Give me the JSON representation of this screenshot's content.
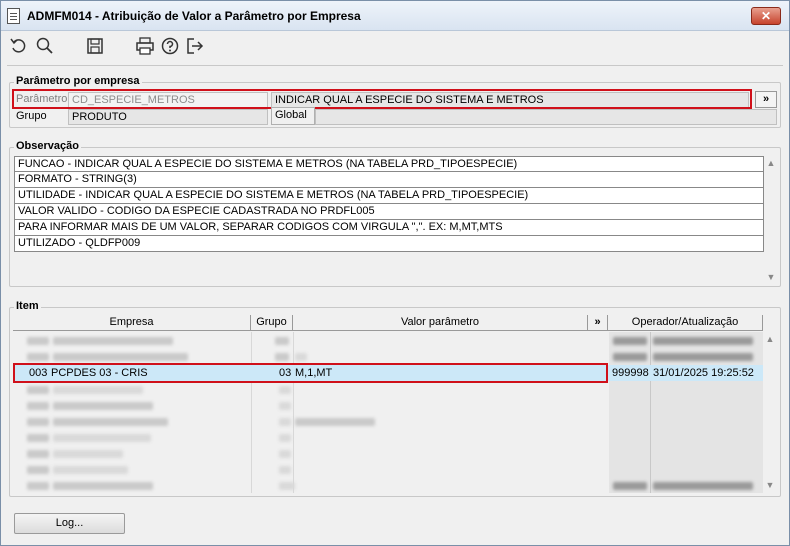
{
  "window": {
    "title": "ADMFM014 - Atribuição de Valor a Parâmetro por Empresa",
    "close_label": "✕"
  },
  "toolbar": {
    "icons": [
      "undo-icon",
      "search-icon",
      "save-icon",
      "print-icon",
      "help-icon",
      "exit-icon"
    ]
  },
  "param_section": {
    "legend": "Parâmetro por empresa",
    "param_label": "Parâmetro",
    "param_code": "CD_ESPECIE_METROS",
    "param_desc": "INDICAR QUAL A ESPECIE DO SISTEMA E METROS",
    "more_label": "»",
    "group_label": "Grupo",
    "group_value": "PRODUTO",
    "scope_value": "Global"
  },
  "obs_section": {
    "legend": "Observação",
    "lines": [
      "FUNCAO - INDICAR QUAL A ESPECIE DO SISTEMA E METROS (NA TABELA PRD_TIPOESPECIE)",
      "FORMATO - STRING(3)",
      "UTILIDADE - INDICAR QUAL A ESPECIE DO SISTEMA E METROS (NA TABELA PRD_TIPOESPECIE)",
      "VALOR VALIDO - CODIGO DA ESPECIE CADASTRADA NO PRDFL005",
      "PARA INFORMAR MAIS DE UM VALOR, SEPARAR CODIGOS COM VIRGULA \",\". EX: M,MT,MTS",
      "UTILIZADO - QLDFP009"
    ]
  },
  "item_section": {
    "legend": "Item",
    "columns": {
      "empresa": "Empresa",
      "grupo": "Grupo",
      "valor": "Valor parâmetro",
      "more": "»",
      "operador": "Operador/Atualização"
    },
    "selected_row": {
      "empresa_code": "003",
      "empresa_name": "PCPDES 03 - CRIS",
      "grupo": "03",
      "valor": "M,1,MT",
      "operador": "999998",
      "atualizacao": "31/01/2025 19:25:52"
    }
  },
  "footer": {
    "log_label": "Log..."
  },
  "colors": {
    "highlight_border": "#d0101a",
    "selected_row_bg": "#cce8f8",
    "window_bg": "#f0f0f0"
  }
}
